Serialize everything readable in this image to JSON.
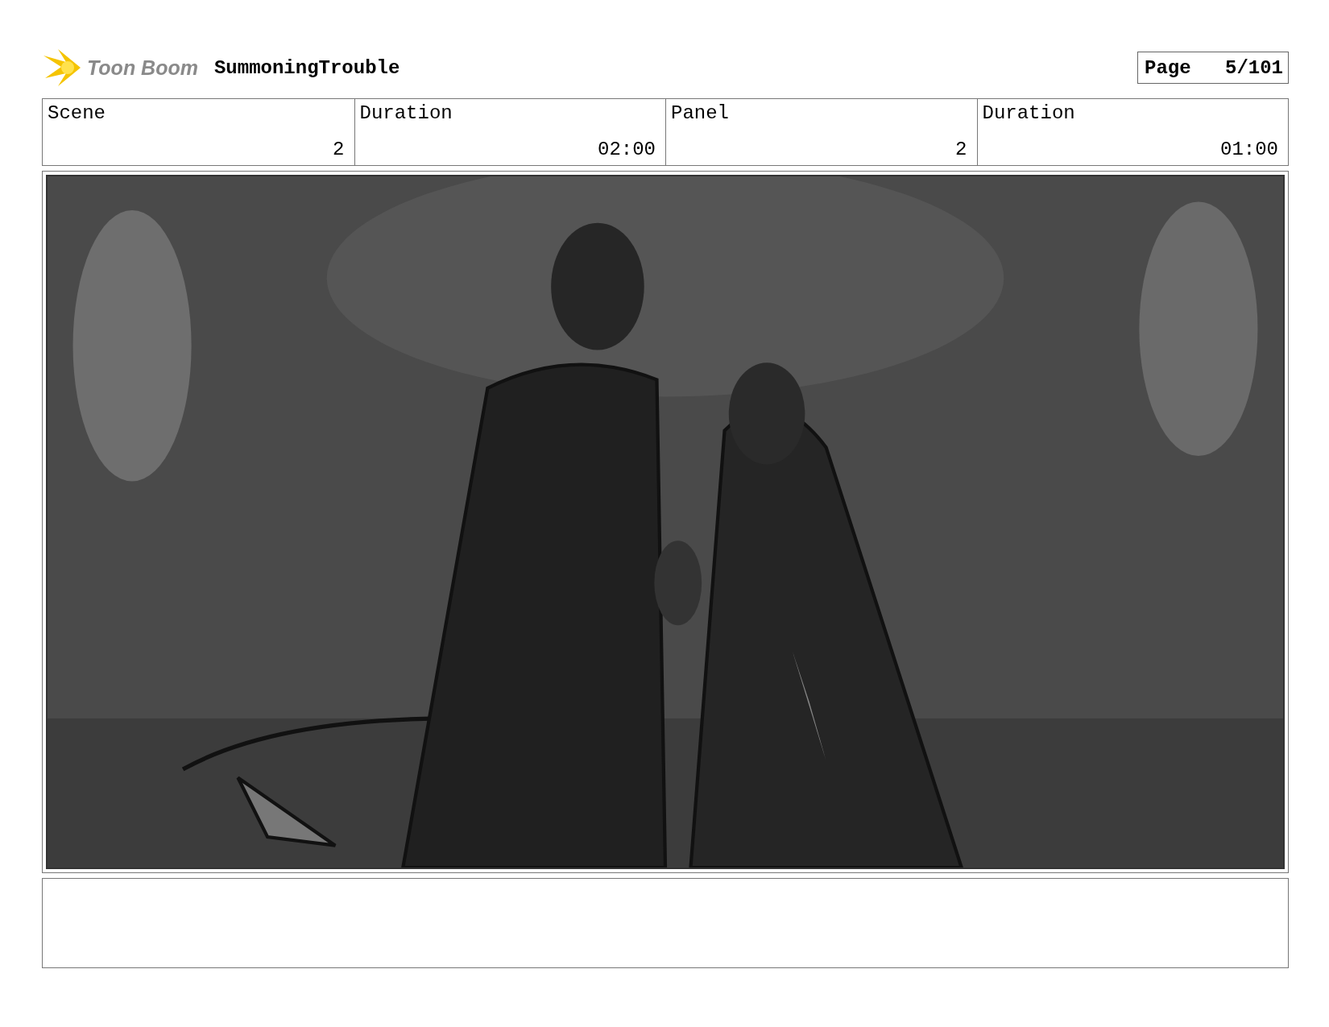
{
  "header": {
    "logo_text": "Toon Boom",
    "title": "SummoningTrouble",
    "page_label": "Page",
    "page_number": "5/101"
  },
  "info": {
    "labels": [
      "Scene",
      "Duration",
      "Panel",
      "Duration"
    ],
    "values": [
      "2",
      "02:00",
      "2",
      "01:00"
    ]
  }
}
